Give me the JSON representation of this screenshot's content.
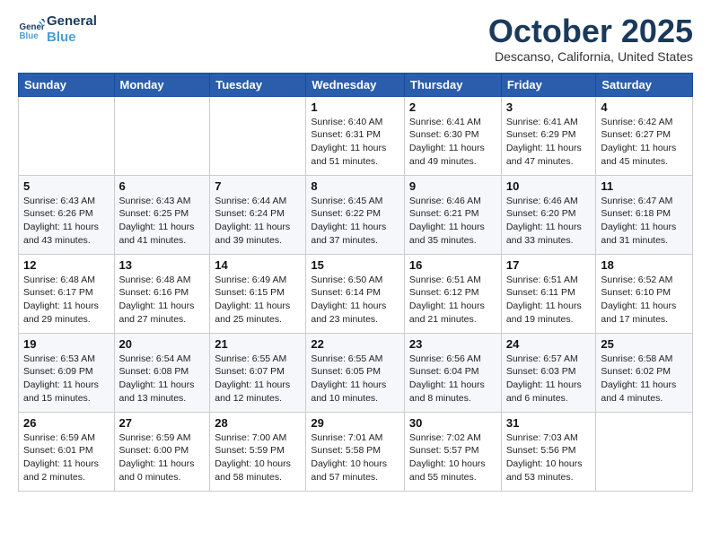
{
  "header": {
    "logo_line1": "General",
    "logo_line2": "Blue",
    "month": "October 2025",
    "location": "Descanso, California, United States"
  },
  "weekdays": [
    "Sunday",
    "Monday",
    "Tuesday",
    "Wednesday",
    "Thursday",
    "Friday",
    "Saturday"
  ],
  "weeks": [
    [
      {
        "day": "",
        "info": ""
      },
      {
        "day": "",
        "info": ""
      },
      {
        "day": "",
        "info": ""
      },
      {
        "day": "1",
        "info": "Sunrise: 6:40 AM\nSunset: 6:31 PM\nDaylight: 11 hours\nand 51 minutes."
      },
      {
        "day": "2",
        "info": "Sunrise: 6:41 AM\nSunset: 6:30 PM\nDaylight: 11 hours\nand 49 minutes."
      },
      {
        "day": "3",
        "info": "Sunrise: 6:41 AM\nSunset: 6:29 PM\nDaylight: 11 hours\nand 47 minutes."
      },
      {
        "day": "4",
        "info": "Sunrise: 6:42 AM\nSunset: 6:27 PM\nDaylight: 11 hours\nand 45 minutes."
      }
    ],
    [
      {
        "day": "5",
        "info": "Sunrise: 6:43 AM\nSunset: 6:26 PM\nDaylight: 11 hours\nand 43 minutes."
      },
      {
        "day": "6",
        "info": "Sunrise: 6:43 AM\nSunset: 6:25 PM\nDaylight: 11 hours\nand 41 minutes."
      },
      {
        "day": "7",
        "info": "Sunrise: 6:44 AM\nSunset: 6:24 PM\nDaylight: 11 hours\nand 39 minutes."
      },
      {
        "day": "8",
        "info": "Sunrise: 6:45 AM\nSunset: 6:22 PM\nDaylight: 11 hours\nand 37 minutes."
      },
      {
        "day": "9",
        "info": "Sunrise: 6:46 AM\nSunset: 6:21 PM\nDaylight: 11 hours\nand 35 minutes."
      },
      {
        "day": "10",
        "info": "Sunrise: 6:46 AM\nSunset: 6:20 PM\nDaylight: 11 hours\nand 33 minutes."
      },
      {
        "day": "11",
        "info": "Sunrise: 6:47 AM\nSunset: 6:18 PM\nDaylight: 11 hours\nand 31 minutes."
      }
    ],
    [
      {
        "day": "12",
        "info": "Sunrise: 6:48 AM\nSunset: 6:17 PM\nDaylight: 11 hours\nand 29 minutes."
      },
      {
        "day": "13",
        "info": "Sunrise: 6:48 AM\nSunset: 6:16 PM\nDaylight: 11 hours\nand 27 minutes."
      },
      {
        "day": "14",
        "info": "Sunrise: 6:49 AM\nSunset: 6:15 PM\nDaylight: 11 hours\nand 25 minutes."
      },
      {
        "day": "15",
        "info": "Sunrise: 6:50 AM\nSunset: 6:14 PM\nDaylight: 11 hours\nand 23 minutes."
      },
      {
        "day": "16",
        "info": "Sunrise: 6:51 AM\nSunset: 6:12 PM\nDaylight: 11 hours\nand 21 minutes."
      },
      {
        "day": "17",
        "info": "Sunrise: 6:51 AM\nSunset: 6:11 PM\nDaylight: 11 hours\nand 19 minutes."
      },
      {
        "day": "18",
        "info": "Sunrise: 6:52 AM\nSunset: 6:10 PM\nDaylight: 11 hours\nand 17 minutes."
      }
    ],
    [
      {
        "day": "19",
        "info": "Sunrise: 6:53 AM\nSunset: 6:09 PM\nDaylight: 11 hours\nand 15 minutes."
      },
      {
        "day": "20",
        "info": "Sunrise: 6:54 AM\nSunset: 6:08 PM\nDaylight: 11 hours\nand 13 minutes."
      },
      {
        "day": "21",
        "info": "Sunrise: 6:55 AM\nSunset: 6:07 PM\nDaylight: 11 hours\nand 12 minutes."
      },
      {
        "day": "22",
        "info": "Sunrise: 6:55 AM\nSunset: 6:05 PM\nDaylight: 11 hours\nand 10 minutes."
      },
      {
        "day": "23",
        "info": "Sunrise: 6:56 AM\nSunset: 6:04 PM\nDaylight: 11 hours\nand 8 minutes."
      },
      {
        "day": "24",
        "info": "Sunrise: 6:57 AM\nSunset: 6:03 PM\nDaylight: 11 hours\nand 6 minutes."
      },
      {
        "day": "25",
        "info": "Sunrise: 6:58 AM\nSunset: 6:02 PM\nDaylight: 11 hours\nand 4 minutes."
      }
    ],
    [
      {
        "day": "26",
        "info": "Sunrise: 6:59 AM\nSunset: 6:01 PM\nDaylight: 11 hours\nand 2 minutes."
      },
      {
        "day": "27",
        "info": "Sunrise: 6:59 AM\nSunset: 6:00 PM\nDaylight: 11 hours\nand 0 minutes."
      },
      {
        "day": "28",
        "info": "Sunrise: 7:00 AM\nSunset: 5:59 PM\nDaylight: 10 hours\nand 58 minutes."
      },
      {
        "day": "29",
        "info": "Sunrise: 7:01 AM\nSunset: 5:58 PM\nDaylight: 10 hours\nand 57 minutes."
      },
      {
        "day": "30",
        "info": "Sunrise: 7:02 AM\nSunset: 5:57 PM\nDaylight: 10 hours\nand 55 minutes."
      },
      {
        "day": "31",
        "info": "Sunrise: 7:03 AM\nSunset: 5:56 PM\nDaylight: 10 hours\nand 53 minutes."
      },
      {
        "day": "",
        "info": ""
      }
    ]
  ]
}
